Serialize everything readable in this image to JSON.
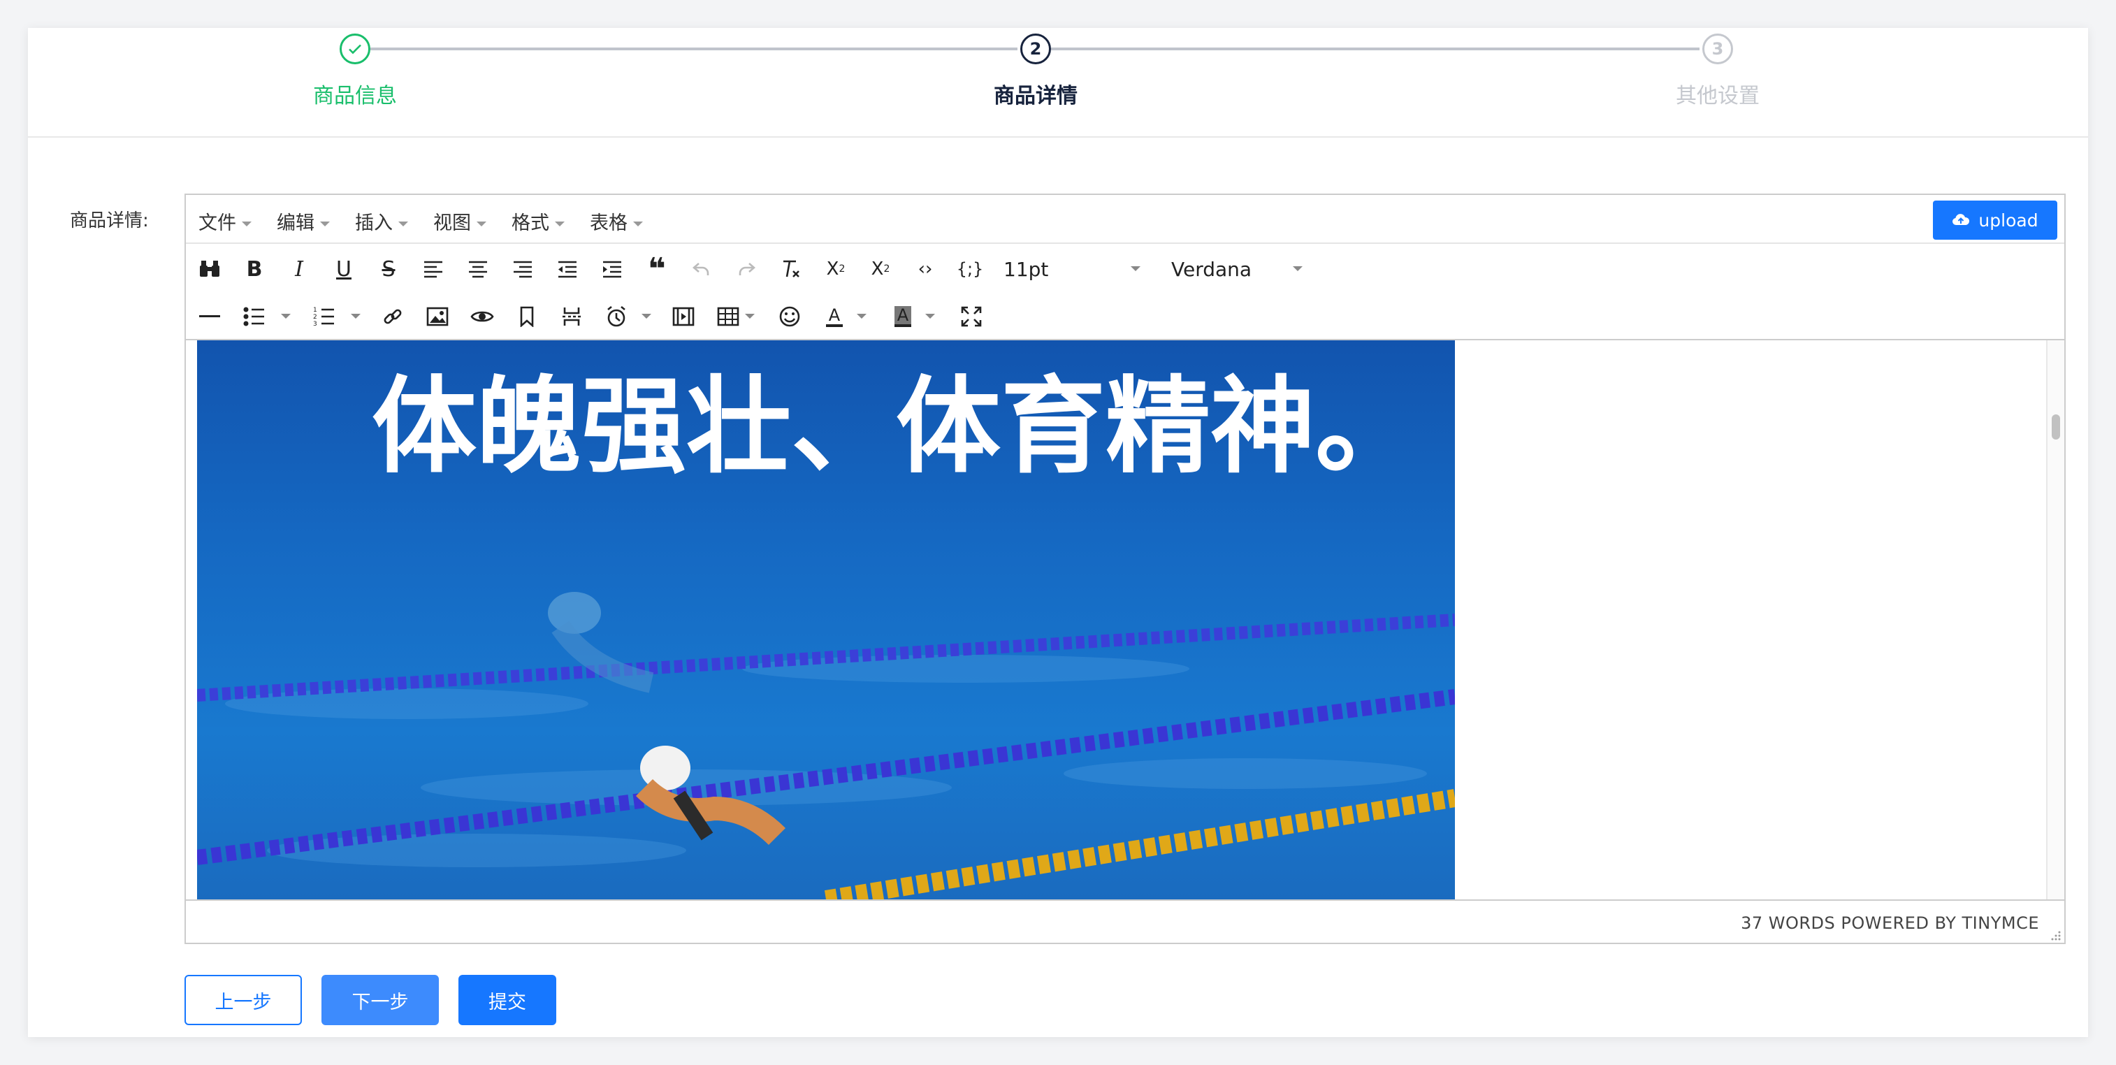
{
  "steps": [
    {
      "title": "商品信息",
      "status": "finished"
    },
    {
      "title": "商品详情",
      "number": "2",
      "status": "current"
    },
    {
      "title": "其他设置",
      "number": "3",
      "status": "pending"
    }
  ],
  "colors": {
    "finished": "#19be6b",
    "current": "#17233d",
    "pending": "#c5c8ce",
    "primary": "#1677ff",
    "primary_light": "#3d8bfd"
  },
  "form": {
    "label": "商品详情:"
  },
  "editor": {
    "menus": [
      "文件",
      "编辑",
      "插入",
      "视图",
      "格式",
      "表格"
    ],
    "upload_label": "upload",
    "font_size": "11pt",
    "font_family": "Verdana",
    "image_caption": "体魄强壮、体育精神。",
    "status": "37 WORDS POWERED BY TINYMCE"
  },
  "buttons": {
    "prev": "上一步",
    "next": "下一步",
    "submit": "提交"
  }
}
